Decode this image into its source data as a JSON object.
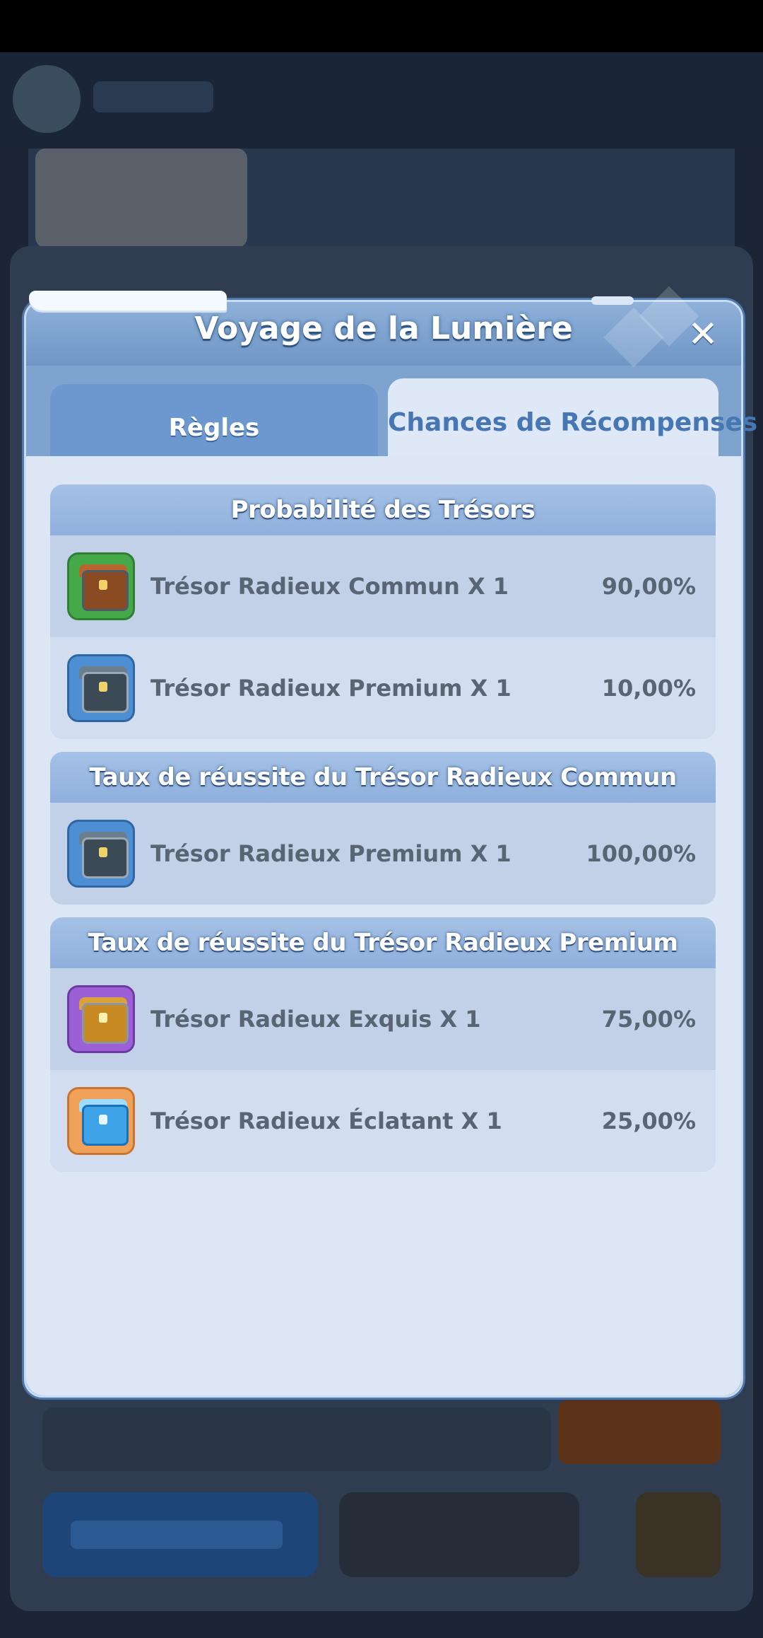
{
  "modal": {
    "title": "Voyage de la Lumière",
    "close_icon": "close-icon",
    "tabs": [
      {
        "label": "Règles",
        "active": false
      },
      {
        "label": "Chances de Récompenses",
        "active": true
      }
    ]
  },
  "sections": [
    {
      "header": "Probabilité des Trésors",
      "items": [
        {
          "name": "Trésor Radieux Commun X 1",
          "pct": "90,00%",
          "icon": "green-chest-icon"
        },
        {
          "name": "Trésor Radieux Premium X 1",
          "pct": "10,00%",
          "icon": "blue-chest-icon"
        }
      ]
    },
    {
      "header": "Taux de réussite du Trésor Radieux Commun",
      "items": [
        {
          "name": "Trésor Radieux Premium X 1",
          "pct": "100,00%",
          "icon": "blue-chest-icon"
        }
      ]
    },
    {
      "header": "Taux de réussite du Trésor Radieux Premium",
      "items": [
        {
          "name": "Trésor Radieux Exquis X 1",
          "pct": "75,00%",
          "icon": "purple-gold-chest-icon"
        },
        {
          "name": "Trésor Radieux Éclatant X 1",
          "pct": "25,00%",
          "icon": "orange-ice-chest-icon"
        }
      ]
    }
  ],
  "colors": {
    "modal_frame": "#7fa3cf",
    "content_bg": "#dce6f5",
    "active_tab_text": "#4677b3",
    "item_text": "#5a6574"
  }
}
